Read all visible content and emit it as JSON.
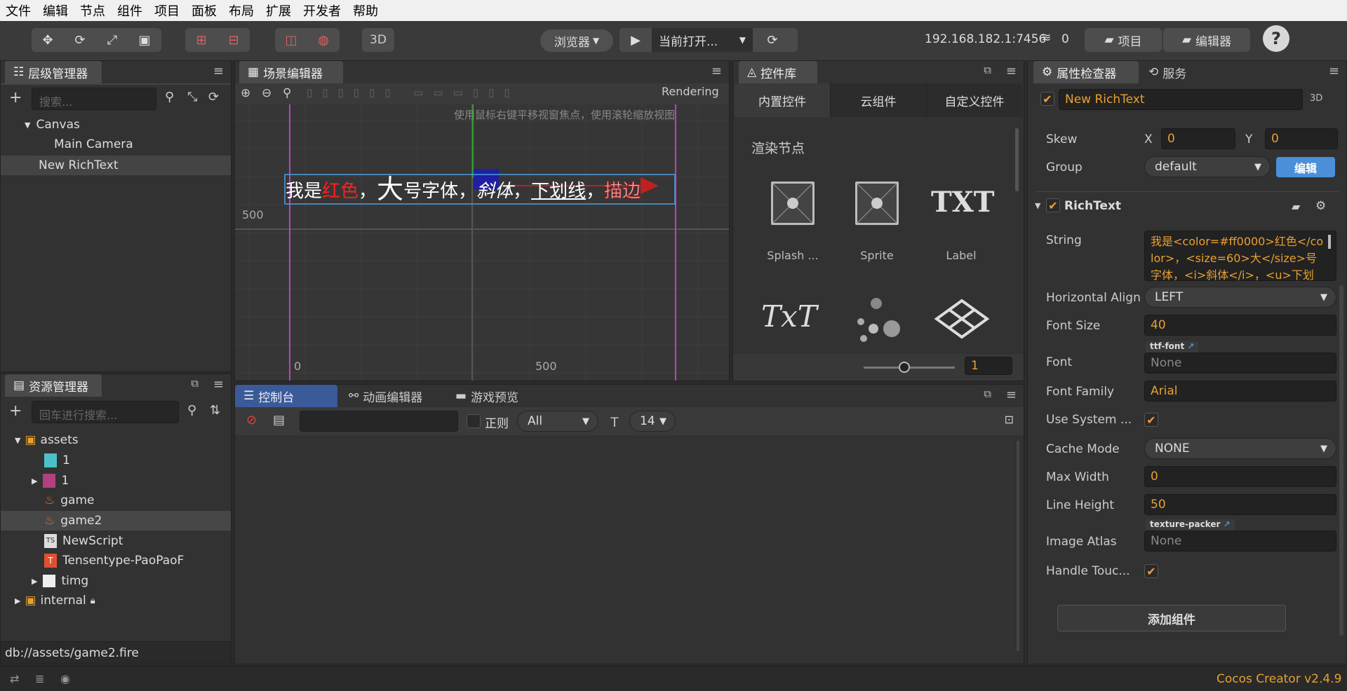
{
  "menu": [
    "文件",
    "编辑",
    "节点",
    "组件",
    "项目",
    "面板",
    "布局",
    "扩展",
    "开发者",
    "帮助"
  ],
  "toolbar": {
    "btn_3d": "3D",
    "browser": "浏览器",
    "current_open": "当前打开...",
    "ip": "192.168.182.1:7456",
    "wifi_count": "0",
    "project": "项目",
    "editor": "编辑器"
  },
  "hierarchy": {
    "title": "层级管理器",
    "search_placeholder": "搜索...",
    "items": [
      "Canvas",
      "Main Camera",
      "New RichText"
    ]
  },
  "scene": {
    "title": "场景编辑器",
    "rendering": "Rendering",
    "hint": "使用鼠标右键平移视窗焦点，使用滚轮缩放视图",
    "label_500_left": "500",
    "label_0_bottom": "0",
    "label_500_bottom": "500",
    "rich_1": "我是",
    "rich_red": "红色",
    "rich_2": "，",
    "rich_big": "大",
    "rich_3": "号字体，",
    "rich_italic": "斜体",
    "rich_4": "，",
    "rich_underline": "下划线",
    "rich_5": "，",
    "rich_6": "描边"
  },
  "widgets": {
    "title": "控件库",
    "tabs": [
      "内置控件",
      "云组件",
      "自定义控件"
    ],
    "section": "渲染节点",
    "items": [
      "Splash ...",
      "Sprite",
      "Label"
    ],
    "zoom_value": "1"
  },
  "assets": {
    "title": "资源管理器",
    "search_placeholder": "回车进行搜索...",
    "items": [
      "assets",
      "1",
      "1",
      "game",
      "game2",
      "NewScript",
      "Tensentype-PaoPaoF",
      "timg",
      "internal"
    ],
    "path": "db://assets/game2.fire"
  },
  "console": {
    "tabs": [
      "控制台",
      "动画编辑器",
      "游戏预览"
    ],
    "regex_label": "正则",
    "filter": "All",
    "font_size": "14"
  },
  "inspector": {
    "tabs": [
      "属性检查器",
      "服务"
    ],
    "node_name": "New RichText",
    "tag_3d": "3D",
    "skew_label": "Skew",
    "skew_x_label": "X",
    "skew_x": "0",
    "skew_y_label": "Y",
    "skew_y": "0",
    "group_label": "Group",
    "group_value": "default",
    "group_edit": "编辑",
    "component": "RichText",
    "string_label": "String",
    "string_value": "我是<color=#ff0000>红色</color>，<size=60>大</size>号字体，<i>斜体</i>，<u>下划",
    "halign_label": "Horizontal Align",
    "halign_value": "LEFT",
    "fontsize_label": "Font Size",
    "fontsize_value": "40",
    "font_label": "Font",
    "font_tag": "ttf-font",
    "font_value": "None",
    "fontfamily_label": "Font Family",
    "fontfamily_value": "Arial",
    "usesystem_label": "Use System ...",
    "cachemode_label": "Cache Mode",
    "cachemode_value": "NONE",
    "maxwidth_label": "Max Width",
    "maxwidth_value": "0",
    "lineheight_label": "Line Height",
    "lineheight_value": "50",
    "atlas_label": "Image Atlas",
    "atlas_tag": "texture-packer",
    "atlas_value": "None",
    "handletouch_label": "Handle Touc...",
    "add_component": "添加组件"
  },
  "status": {
    "version": "Cocos Creator v2.4.9"
  },
  "colors": {
    "accent": "#e8a030",
    "blue_button": "#4a8fd8",
    "selection": "#4a4a4a"
  }
}
